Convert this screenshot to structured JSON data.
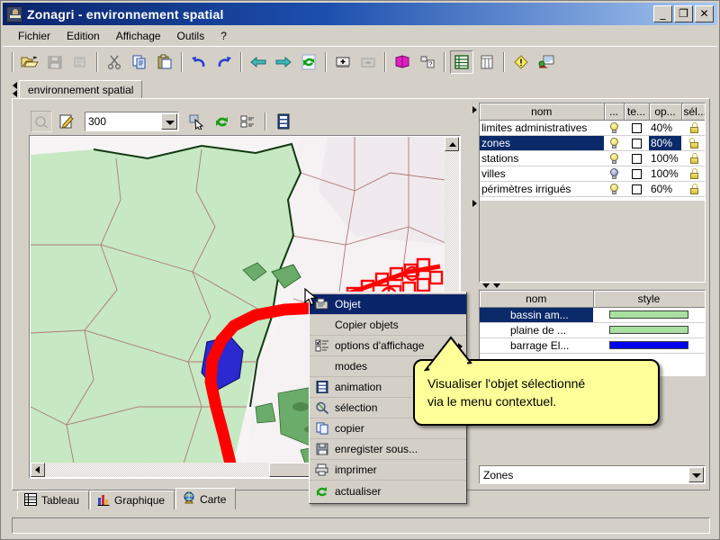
{
  "window": {
    "title": "Zonagri - environnement spatial",
    "icon": "app-icon",
    "buttons": {
      "minimize": "_",
      "maximize": "❐",
      "close": "✕"
    }
  },
  "menubar": {
    "items": [
      "Fichier",
      "Edition",
      "Affichage",
      "Outils",
      "?"
    ]
  },
  "toolbar": {
    "buttons": [
      {
        "name": "open-icon",
        "glyph": "📂",
        "state": "normal"
      },
      {
        "name": "save-icon",
        "glyph": "💾",
        "state": "disabled"
      },
      {
        "name": "print-preview-icon",
        "glyph": "🖇",
        "state": "disabled"
      },
      {
        "name": "cut-icon",
        "glyph": "✂",
        "state": "normal"
      },
      {
        "name": "copy-icon",
        "glyph": "⧉",
        "state": "normal"
      },
      {
        "name": "paste-icon",
        "glyph": "📋",
        "state": "normal"
      },
      {
        "name": "undo-icon",
        "glyph": "↶",
        "state": "normal"
      },
      {
        "name": "redo-icon",
        "glyph": "↷",
        "state": "normal"
      },
      {
        "name": "back-icon",
        "glyph": "⬅",
        "state": "normal"
      },
      {
        "name": "forward-icon",
        "glyph": "➡",
        "state": "normal"
      },
      {
        "name": "refresh-icon",
        "glyph": "⟳",
        "state": "normal"
      },
      {
        "name": "add-window-icon",
        "glyph": "⊞",
        "state": "normal"
      },
      {
        "name": "remove-window-icon",
        "glyph": "⊟",
        "state": "disabled"
      },
      {
        "name": "book-icon",
        "glyph": "📕",
        "state": "normal"
      },
      {
        "name": "query-icon",
        "glyph": "⁇",
        "state": "normal"
      },
      {
        "name": "table-view-icon",
        "glyph": "▤",
        "state": "pressed"
      },
      {
        "name": "grid-view-icon",
        "glyph": "▥",
        "state": "normal"
      },
      {
        "name": "warning-icon",
        "glyph": "⚠",
        "state": "normal"
      },
      {
        "name": "map-tool-icon",
        "glyph": "🗺",
        "state": "normal"
      }
    ]
  },
  "document_tab": {
    "label": "environnement spatial"
  },
  "map_toolbar": {
    "select-tool": {
      "name": "selection-lasso-icon",
      "state": "disabled"
    },
    "edit-tool": {
      "name": "edit-pencil-icon",
      "state": "normal"
    },
    "scale": {
      "value": "300",
      "placeholder": ""
    },
    "buttons": [
      {
        "name": "pointer-select-icon",
        "state": "normal"
      },
      {
        "name": "refresh-map-icon",
        "state": "normal"
      },
      {
        "name": "display-options-icon",
        "state": "normal"
      },
      {
        "name": "animation-icon",
        "state": "normal"
      }
    ]
  },
  "layers_table": {
    "columns": [
      "nom",
      "...",
      "te...",
      "op...",
      "sél..."
    ],
    "rows": [
      {
        "nom": "limites administratives",
        "visible": true,
        "te": false,
        "op": "40%",
        "locked": true,
        "selected": false
      },
      {
        "nom": "zones",
        "visible": true,
        "te": false,
        "op": "80%",
        "locked": false,
        "selected": true
      },
      {
        "nom": "stations",
        "visible": true,
        "te": false,
        "op": "100%",
        "locked": true,
        "selected": false
      },
      {
        "nom": "villes",
        "visible": false,
        "te": false,
        "op": "100%",
        "locked": true,
        "selected": false
      },
      {
        "nom": "périmètres irrigués",
        "visible": true,
        "te": false,
        "op": "60%",
        "locked": true,
        "selected": false
      }
    ]
  },
  "objects_table": {
    "columns": [
      "nom",
      "style"
    ],
    "rows": [
      {
        "nom": "bassin am...",
        "style_color": "#a8e0a0",
        "selected": true
      },
      {
        "nom": "plaine de ...",
        "style_color": "#a8e0a0",
        "selected": false
      },
      {
        "nom": "barrage El...",
        "style_color": "#0000ee",
        "selected": false
      }
    ]
  },
  "layer_combo": {
    "value": "Zones"
  },
  "context_menu": {
    "items": [
      {
        "label": "Objet",
        "icon": "object-icon",
        "selected": true,
        "submenu": false
      },
      {
        "label": "Copier objets",
        "icon": "",
        "selected": false,
        "submenu": false
      },
      {
        "label": "options d'affichage",
        "icon": "display-options-icon",
        "selected": false,
        "submenu": true
      },
      {
        "label": "modes",
        "icon": "",
        "selected": false,
        "submenu": false
      },
      {
        "label": "animation",
        "icon": "animation-icon",
        "selected": false,
        "submenu": false
      },
      {
        "label": "sélection",
        "icon": "selection-icon",
        "selected": false,
        "submenu": false
      },
      {
        "label": "copier",
        "icon": "copy-icon",
        "selected": false,
        "submenu": false
      },
      {
        "label": "enregister sous...",
        "icon": "save-as-icon",
        "selected": false,
        "submenu": false
      },
      {
        "label": "imprimer",
        "icon": "print-icon",
        "selected": false,
        "submenu": false
      },
      {
        "label": "actualiser",
        "icon": "refresh-icon",
        "selected": false,
        "submenu": false
      }
    ]
  },
  "balloon": {
    "line1": "Visualiser l'objet sélectionné",
    "line2": "via le menu contextuel."
  },
  "bottom_tabs": [
    {
      "label": "Tableau",
      "icon": "table-icon",
      "active": false
    },
    {
      "label": "Graphique",
      "icon": "bar-chart-icon",
      "active": false
    },
    {
      "label": "Carte",
      "icon": "globe-icon",
      "active": true
    }
  ],
  "colors": {
    "title_start": "#0a246a",
    "title_end": "#a6c6f0",
    "face": "#d4d0c8",
    "selection": "#0a246a",
    "map_green": "#bfe6bf",
    "map_dark_green": "#6fae6f",
    "map_red": "#ff0000",
    "map_blue": "#2222cc",
    "balloon": "#ffff99"
  }
}
